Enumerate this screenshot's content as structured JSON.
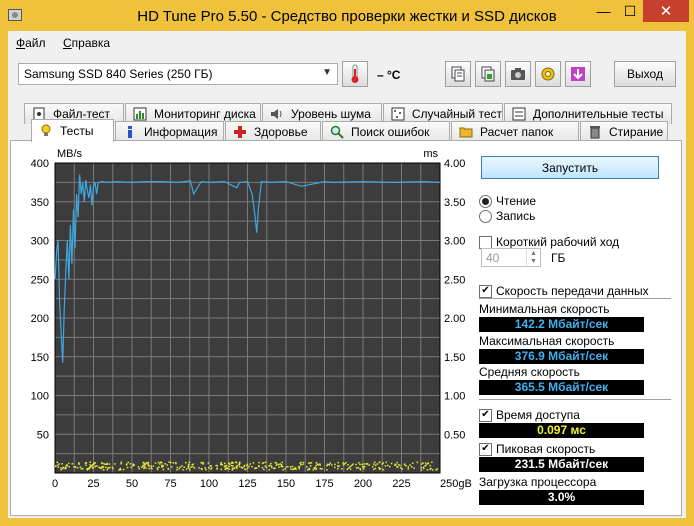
{
  "window": {
    "title": "HD Tune Pro 5.50 - Средство проверки жестки и SSD дисков",
    "controls": {
      "minimize": "—",
      "maximize": "☐",
      "close": "✕"
    }
  },
  "menu": {
    "items": [
      {
        "first": "Ф",
        "rest": "айл"
      },
      {
        "first": "С",
        "rest": "правка"
      }
    ]
  },
  "toolbar": {
    "drive": "Samsung SSD 840 Series (250 ГБ)",
    "temperature": "– °C",
    "exit_label": "Выход",
    "icons": [
      "copy-text-icon",
      "copy-screenshot-icon",
      "camera-icon",
      "options-icon",
      "save-download-icon"
    ]
  },
  "tabs_back": [
    {
      "label": "Файл-тест",
      "icon": "file-test-icon"
    },
    {
      "label": "Мониторинг диска",
      "icon": "disk-monitor-icon"
    },
    {
      "label": "Уровень шума",
      "icon": "speaker-icon"
    },
    {
      "label": "Случайный тест",
      "icon": "random-test-icon"
    },
    {
      "label": "Дополнительные тесты",
      "icon": "extra-tests-icon"
    }
  ],
  "tabs_front": [
    {
      "label": "Тесты",
      "icon": "benchmark-bulb-icon"
    },
    {
      "label": "Информация",
      "icon": "info-icon"
    },
    {
      "label": "Здоровье",
      "icon": "health-cross-icon"
    },
    {
      "label": "Поиск ошибок",
      "icon": "error-scan-icon"
    },
    {
      "label": "Расчет папок",
      "icon": "folder-usage-icon"
    },
    {
      "label": "Стирание",
      "icon": "erase-trash-icon"
    }
  ],
  "benchmark": {
    "start_label": "Запустить",
    "read_label": "Чтение",
    "write_label": "Запись",
    "short_stroke_label": "Короткий рабочий ход",
    "short_stroke_value": "40",
    "short_stroke_unit": "ГБ",
    "transfer_rate_label": "Скорость передачи данных",
    "min_label": "Минимальная скорость",
    "min_value": "142.2 Мбайт/сек",
    "max_label": "Максимальная скорость",
    "max_value": "376.9 Мбайт/сек",
    "avg_label": "Средняя скорость",
    "avg_value": "365.5 Мбайт/сек",
    "access_time_label": "Время доступа",
    "access_time_value": "0.097 мс",
    "burst_label": "Пиковая скорость",
    "burst_value": "231.5 Мбайт/сек",
    "cpu_label": "Загрузка процессора",
    "cpu_value": "3.0%",
    "read_selected": true,
    "short_stroke_checked": false,
    "transfer_rate_checked": true,
    "access_time_checked": true,
    "burst_checked": true
  },
  "colors": {
    "title_bar": "#f0c23c",
    "chart_bg": "#3c3c3c",
    "grid": "#7a7a7a",
    "transfer_line": "#3fa7e0",
    "access_points": "#e8e83a",
    "value_blue": "#3fb0f0",
    "value_yellow": "#f2f230"
  },
  "chart_data": {
    "type": "line",
    "y_left_unit": "MB/s",
    "y_right_unit": "ms",
    "y_left_ticks": [
      "400",
      "350",
      "300",
      "250",
      "200",
      "150",
      "100",
      "50"
    ],
    "y_right_ticks": [
      "4.00",
      "3.50",
      "3.00",
      "2.50",
      "2.00",
      "1.50",
      "1.00",
      "0.50"
    ],
    "x_ticks": [
      "0",
      "25",
      "50",
      "75",
      "100",
      "125",
      "150",
      "175",
      "200",
      "225",
      "250gB"
    ],
    "ylim_left": [
      0,
      400
    ],
    "ylim_right": [
      0,
      4
    ],
    "xlim": [
      0,
      250
    ],
    "grid": true,
    "series": [
      {
        "x": [
          0,
          1,
          2,
          3,
          4,
          5,
          6,
          7,
          8,
          9,
          10,
          11,
          12,
          13,
          14,
          15,
          16,
          17,
          18,
          19,
          20,
          21,
          22,
          23,
          24,
          25,
          26,
          27,
          28,
          30,
          35,
          40,
          50,
          60,
          70,
          80,
          88,
          90,
          95,
          100,
          110,
          118,
          120,
          125,
          128,
          130,
          131,
          132,
          134,
          140,
          150,
          160,
          175,
          180,
          200,
          220,
          240,
          250
        ],
        "y": [
          250,
          285,
          300,
          220,
          180,
          142,
          210,
          260,
          300,
          250,
          320,
          270,
          340,
          290,
          360,
          330,
          385,
          360,
          375,
          350,
          378,
          365,
          355,
          372,
          345,
          370,
          375,
          360,
          374,
          376,
          375,
          376,
          375,
          376,
          376,
          375,
          377,
          360,
          376,
          375,
          376,
          368,
          375,
          376,
          360,
          330,
          310,
          340,
          376,
          375,
          376,
          370,
          376,
          375,
          376,
          375,
          376,
          375
        ]
      }
    ],
    "access_time_band_ms": [
      0.05,
      0.15
    ]
  }
}
